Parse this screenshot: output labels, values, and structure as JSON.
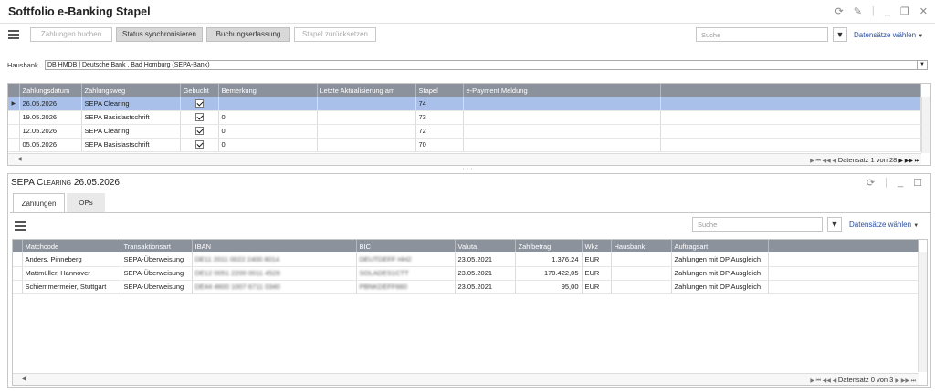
{
  "app": {
    "title": "Softfolio e-Banking Stapel"
  },
  "toolbar": {
    "buttons": [
      {
        "label": "Zahlungen buchen",
        "state": "disabled"
      },
      {
        "label": "Status synchronisieren",
        "state": "active"
      },
      {
        "label": "Buchungserfassung",
        "state": "active"
      },
      {
        "label": "Stapel zurücksetzen",
        "state": "disabled"
      }
    ],
    "search_placeholder": "Suche",
    "choose_records": "Datensätze wählen"
  },
  "hausbank": {
    "label": "Hausbank",
    "value": "DB HMDB  |  Deutsche Bank , Bad Homburg (SEPA-Bank)"
  },
  "batch_grid": {
    "columns": [
      "Zahlungsdatum",
      "Zahlungsweg",
      "Gebucht",
      "Bemerkung",
      "Letzte Aktualisierung am",
      "Stapel",
      "e-Payment Meldung"
    ],
    "rows": [
      {
        "date": "26.05.2026",
        "way": "SEPA Clearing",
        "booked": true,
        "note": "",
        "updated": "",
        "batch": "74",
        "epay": ""
      },
      {
        "date": "19.05.2026",
        "way": "SEPA Basislastschrift",
        "booked": true,
        "note": "0",
        "updated": "",
        "batch": "73",
        "epay": ""
      },
      {
        "date": "12.05.2026",
        "way": "SEPA Clearing",
        "booked": true,
        "note": "0",
        "updated": "",
        "batch": "72",
        "epay": ""
      },
      {
        "date": "05.05.2026",
        "way": "SEPA Basislastschrift",
        "booked": true,
        "note": "0",
        "updated": "",
        "batch": "70",
        "epay": ""
      }
    ],
    "pager": "Datensatz 1 von 28"
  },
  "detail": {
    "title": "SEPA Clearing 26.05.2026",
    "tabs": [
      "Zahlungen",
      "OPs"
    ],
    "search_placeholder": "Suche",
    "choose_records": "Datensätze wählen",
    "columns": [
      "Matchcode",
      "Transaktionsart",
      "IBAN",
      "BIC",
      "Valuta",
      "Zahlbetrag",
      "Wkz",
      "Hausbank",
      "Auftragsart"
    ],
    "rows": [
      {
        "matchcode": "Anders, Pinneberg",
        "type": "SEPA-Überweisung",
        "iban": "DE11 2011 0022 2400 8014",
        "bic": "DEUTDEFF HH2",
        "valuta": "23.05.2021",
        "amount": "1.376,24",
        "wkz": "EUR",
        "hausbank": "",
        "order": "Zahlungen mit OP Ausgleich"
      },
      {
        "matchcode": "Mattmüller, Hannover",
        "type": "SEPA-Überweisung",
        "iban": "DE12 0051 2200 0011 4528",
        "bic": "SOLADES1CTT",
        "valuta": "23.05.2021",
        "amount": "170.422,05",
        "wkz": "EUR",
        "hausbank": "",
        "order": "Zahlungen mit OP Ausgleich"
      },
      {
        "matchcode": "Schiemmermeier, Stuttgart",
        "type": "SEPA-Überweisung",
        "iban": "DE44 4600 1007 6711 0340",
        "bic": "PBNKDEFF660",
        "valuta": "23.05.2021",
        "amount": "95,00",
        "wkz": "EUR",
        "hausbank": "",
        "order": "Zahlungen mit OP Ausgleich"
      }
    ],
    "pager": "Datensatz 0 von 3"
  }
}
